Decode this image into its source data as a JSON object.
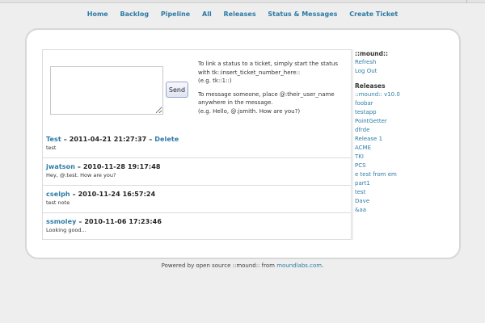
{
  "nav": {
    "items": [
      "Home",
      "Backlog",
      "Pipeline",
      "All",
      "Releases",
      "Status & Messages",
      "Create Ticket"
    ]
  },
  "composer": {
    "send_label": "Send",
    "help_line1": "To link a status to a ticket, simply start the status with tk::insert_ticket_number_here::",
    "help_line2": "(e.g. tk::1::)",
    "help_line3": "To message someone, place @:their_user_name anywhere in the message.",
    "help_line4": "(e.g. Hello, @:jsmith. How are you?)"
  },
  "messages": [
    {
      "user": "Test",
      "sep": " – ",
      "timestamp": "2011-04-21 21:27:37",
      "delete_sep": " – ",
      "delete_label": "Delete",
      "body": "test"
    },
    {
      "user": "jwatson",
      "sep": " – ",
      "timestamp": "2010-11-28 19:17:48",
      "body": "Hey, @:test. How are you?"
    },
    {
      "user": "cselph",
      "sep": " – ",
      "timestamp": "2010-11-24 16:57:24",
      "body": "test note"
    },
    {
      "user": "ssmoley",
      "sep": " – ",
      "timestamp": "2010-11-06 17:23:46",
      "body": "Looking good..."
    }
  ],
  "sidebar": {
    "account_title": "::mound::",
    "account_links": [
      "Refresh",
      "Log Out"
    ],
    "releases_title": "Releases",
    "releases": [
      "::mound:: v10.0",
      "foobar",
      "testapp",
      "PointGetter",
      "dfrde",
      "Release 1",
      "ACME",
      "TKI",
      "PCS",
      "e test from em",
      "part1",
      "test",
      "Dave",
      "&aa"
    ]
  },
  "footer": {
    "prefix": "Powered by open source ::mound:: from ",
    "link": "moundlabs.com",
    "suffix": "."
  }
}
